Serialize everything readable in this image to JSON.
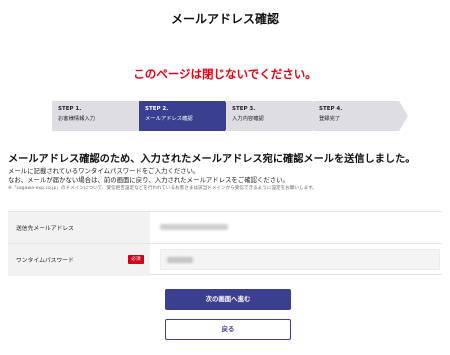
{
  "page": {
    "title": "メールアドレス確認",
    "warning": "このページは閉じないでください。"
  },
  "steps": [
    {
      "num": "STEP 1.",
      "label": "お客様情報入力",
      "active": false
    },
    {
      "num": "STEP 2.",
      "label": "メールアドレス確認",
      "active": true
    },
    {
      "num": "STEP 3.",
      "label": "入力内容確認",
      "active": false
    },
    {
      "num": "STEP 4.",
      "label": "登録完了",
      "active": false
    }
  ],
  "main": {
    "headline": "メールアドレス確認のため、入力されたメールアドレス宛に確認メールを送信しました。",
    "note1": "メールに記載されているワンタイムパスワードをご入力ください。",
    "note2": "なお、メールが届かない場合は、前の画面に戻り、入力されたメールアドレスをご確認ください。",
    "note_small": "※「sagawa-exp.co.jp」のドメインについて、受信拒否設定などを行われているお客さまは該当ドメインから受信できるように設定をお願いします。"
  },
  "form": {
    "email_label": "送信先メールアドレス",
    "password_label": "ワンタイムパスワード",
    "required_badge": "必須"
  },
  "buttons": {
    "next": "次の画面へ進む",
    "back": "戻る"
  },
  "colors": {
    "accent": "#3b3f8f",
    "warning": "#e60012",
    "required": "#d0021b"
  }
}
